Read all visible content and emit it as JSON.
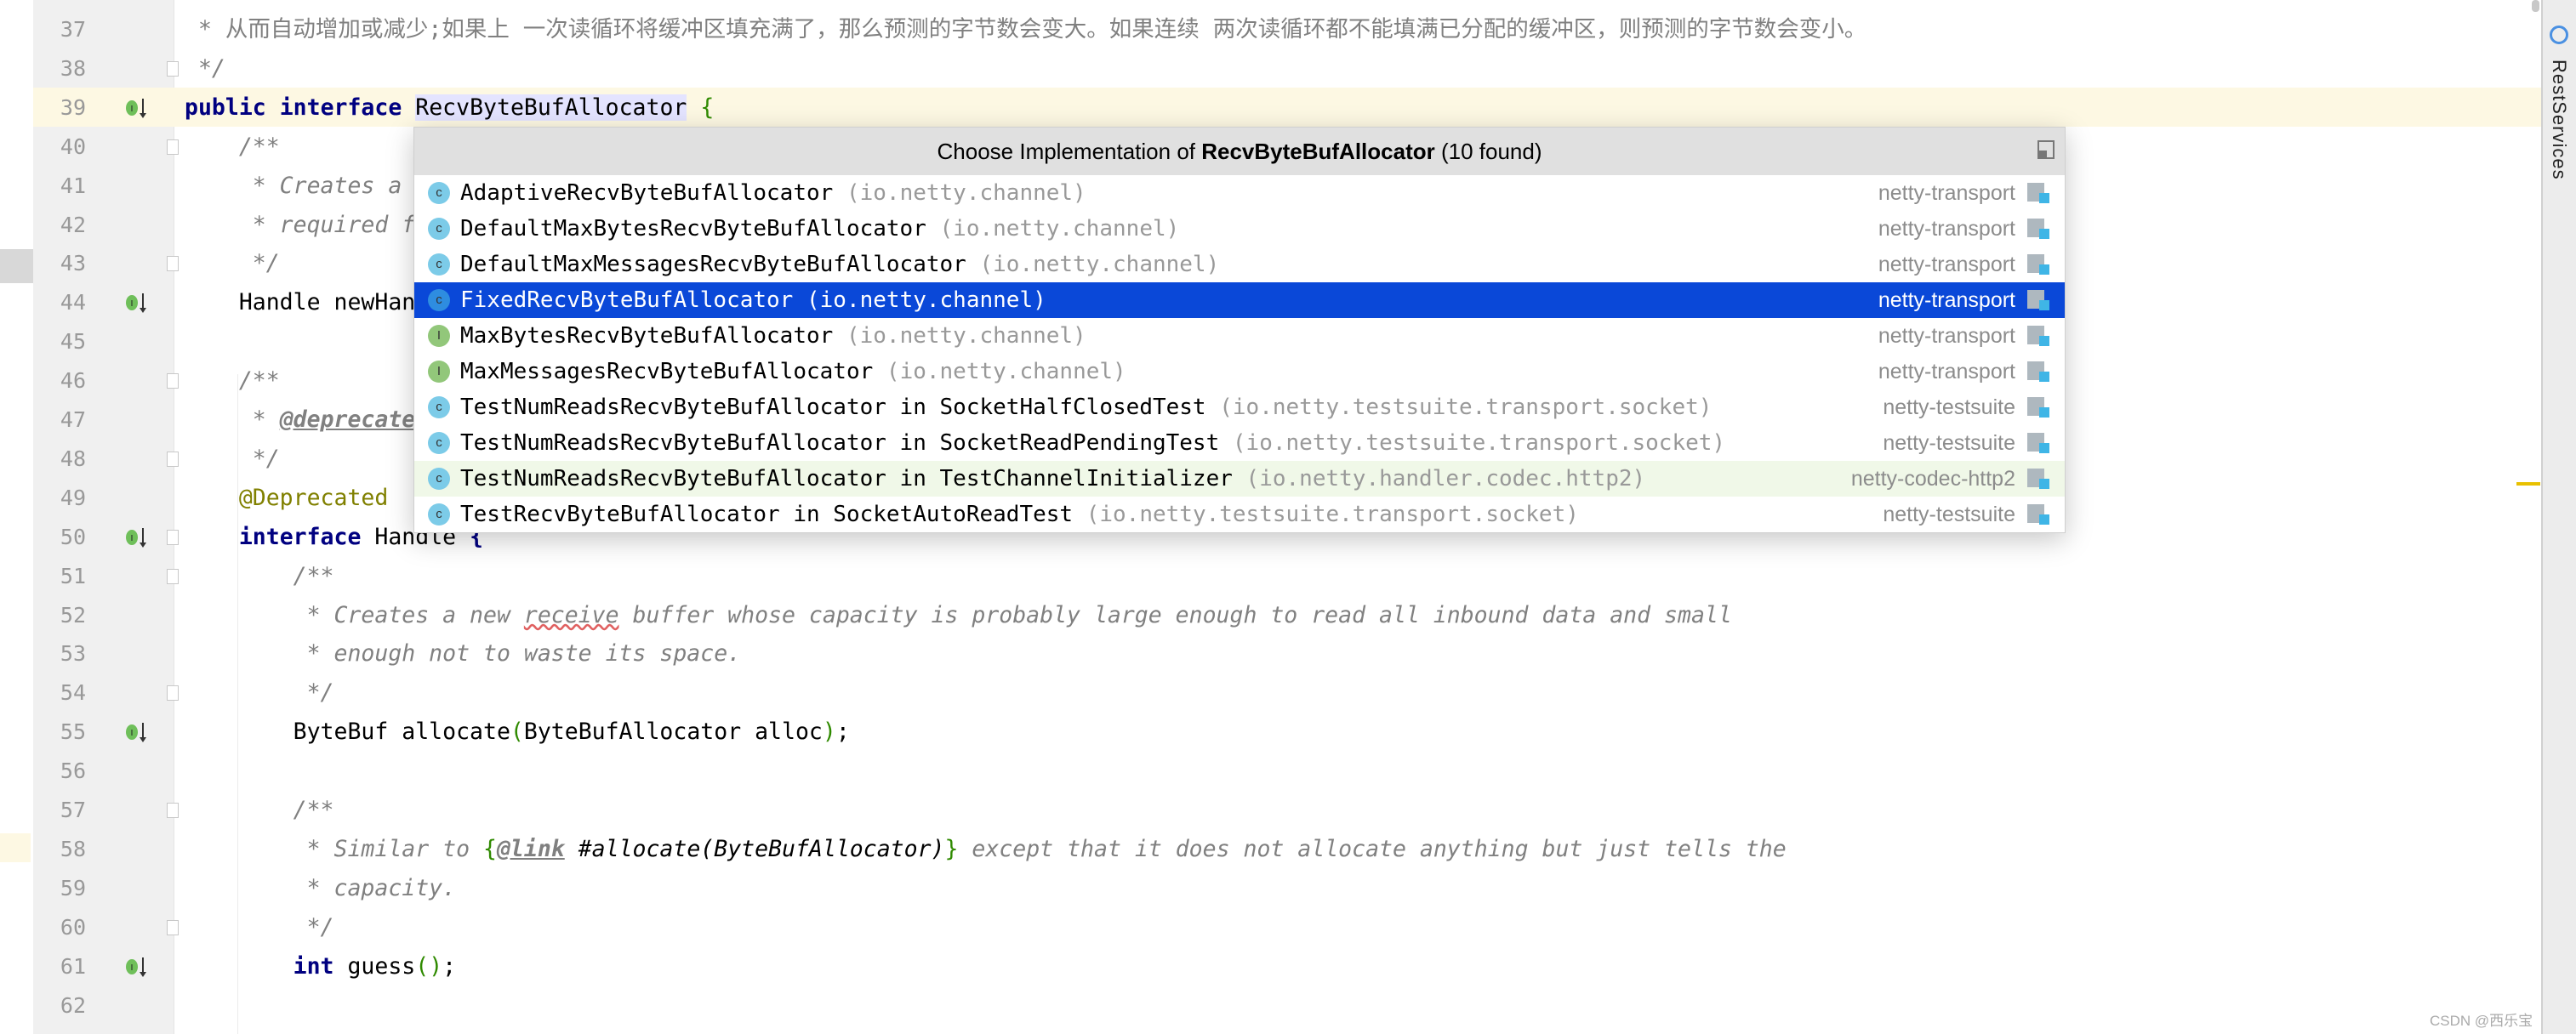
{
  "editor": {
    "current_line": 39,
    "lines": [
      {
        "n": "37",
        "gutter": null,
        "fold": false,
        "tokens": [
          {
            "t": " * 从而自动增加或减少;如果上 一次读循环将缓冲区填充满了，那么预测的字节数会变大。如果连续 两次读循环都不能填满已分配的缓冲区，则预测的字节数会变小。",
            "c": "cmn"
          }
        ]
      },
      {
        "n": "38",
        "gutter": null,
        "fold": true,
        "tokens": [
          {
            "t": " */",
            "c": "cm"
          }
        ]
      },
      {
        "n": "39",
        "gutter": "implemented-icon",
        "fold": false,
        "tokens": [
          {
            "t": "public",
            "c": "kw"
          },
          {
            "t": " ",
            "c": ""
          },
          {
            "t": "interface",
            "c": "kw"
          },
          {
            "t": " ",
            "c": ""
          },
          {
            "t": "RecvByteBufAllocator",
            "c": "hl"
          },
          {
            "t": " ",
            "c": ""
          },
          {
            "t": "{",
            "c": "gr"
          }
        ]
      },
      {
        "n": "40",
        "gutter": null,
        "fold": true,
        "tokens": [
          {
            "t": "    /**",
            "c": "cm"
          }
        ]
      },
      {
        "n": "41",
        "gutter": null,
        "fold": false,
        "tokens": [
          {
            "t": "     * Creates a",
            "c": "cm"
          }
        ]
      },
      {
        "n": "42",
        "gutter": null,
        "fold": false,
        "tokens": [
          {
            "t": "     * required f",
            "c": "cm"
          }
        ]
      },
      {
        "n": "43",
        "gutter": null,
        "fold": true,
        "tokens": [
          {
            "t": "     */",
            "c": "cm"
          }
        ]
      },
      {
        "n": "44",
        "gutter": "implemented-icon",
        "fold": false,
        "tokens": [
          {
            "t": "    Handle newHan",
            "c": ""
          }
        ]
      },
      {
        "n": "45",
        "gutter": null,
        "fold": false,
        "tokens": []
      },
      {
        "n": "46",
        "gutter": null,
        "fold": true,
        "tokens": [
          {
            "t": "    /**",
            "c": "cm"
          }
        ]
      },
      {
        "n": "47",
        "gutter": null,
        "fold": false,
        "tokens": [
          {
            "t": "     * ",
            "c": "cm"
          },
          {
            "t": "@deprecate",
            "c": "tag"
          }
        ]
      },
      {
        "n": "48",
        "gutter": null,
        "fold": true,
        "tokens": [
          {
            "t": "     */",
            "c": "cm"
          }
        ]
      },
      {
        "n": "49",
        "gutter": null,
        "fold": false,
        "tokens": [
          {
            "t": "    @Deprecated",
            "c": "ann"
          }
        ]
      },
      {
        "n": "50",
        "gutter": "implemented-icon",
        "fold": true,
        "tokens": [
          {
            "t": "    ",
            "c": ""
          },
          {
            "t": "interface",
            "c": "kw"
          },
          {
            "t": " Handle ",
            "c": ""
          },
          {
            "t": "{",
            "c": "kw"
          }
        ]
      },
      {
        "n": "51",
        "gutter": null,
        "fold": true,
        "tokens": [
          {
            "t": "        /**",
            "c": "cm"
          }
        ]
      },
      {
        "n": "52",
        "gutter": null,
        "fold": false,
        "tokens": [
          {
            "t": "         * Creates a new ",
            "c": "cm"
          },
          {
            "t": "receive",
            "c": "typo"
          },
          {
            "t": " buffer whose capacity is probably large enough to read all inbound data and small",
            "c": "cm"
          }
        ]
      },
      {
        "n": "53",
        "gutter": null,
        "fold": false,
        "tokens": [
          {
            "t": "         * enough not to waste its space.",
            "c": "cm"
          }
        ]
      },
      {
        "n": "54",
        "gutter": null,
        "fold": true,
        "tokens": [
          {
            "t": "         */",
            "c": "cm"
          }
        ]
      },
      {
        "n": "55",
        "gutter": "implemented-icon",
        "fold": false,
        "tokens": [
          {
            "t": "        ByteBuf allocate",
            "c": ""
          },
          {
            "t": "(",
            "c": "gr"
          },
          {
            "t": "ByteBufAllocator alloc",
            "c": ""
          },
          {
            "t": ")",
            "c": "gr"
          },
          {
            "t": ";",
            "c": ""
          }
        ]
      },
      {
        "n": "56",
        "gutter": null,
        "fold": false,
        "tokens": []
      },
      {
        "n": "57",
        "gutter": null,
        "fold": true,
        "tokens": [
          {
            "t": "        /**",
            "c": "cm"
          }
        ]
      },
      {
        "n": "58",
        "gutter": null,
        "fold": false,
        "tokens": [
          {
            "t": "         * Similar to ",
            "c": "cm"
          },
          {
            "t": "{",
            "c": "gr"
          },
          {
            "t": "@link",
            "c": "tag"
          },
          {
            "t": " #allocate(ByteBufAllocator)",
            "c": "ref"
          },
          {
            "t": "}",
            "c": "gr"
          },
          {
            "t": " except that it does not allocate anything but just tells the",
            "c": "cm"
          }
        ]
      },
      {
        "n": "59",
        "gutter": null,
        "fold": false,
        "tokens": [
          {
            "t": "         * capacity.",
            "c": "cm"
          }
        ]
      },
      {
        "n": "60",
        "gutter": null,
        "fold": true,
        "tokens": [
          {
            "t": "         */",
            "c": "cm"
          }
        ]
      },
      {
        "n": "61",
        "gutter": "implemented-icon",
        "fold": false,
        "tokens": [
          {
            "t": "        ",
            "c": ""
          },
          {
            "t": "int",
            "c": "kw"
          },
          {
            "t": " guess",
            "c": ""
          },
          {
            "t": "()",
            "c": "gr"
          },
          {
            "t": ";",
            "c": ""
          }
        ]
      },
      {
        "n": "62",
        "gutter": null,
        "fold": false,
        "tokens": []
      }
    ]
  },
  "popup": {
    "title_prefix": "Choose Implementation of ",
    "title_bold": "RecvByteBufAllocator",
    "title_suffix": " (10 found)",
    "items": [
      {
        "icon": "class-icon",
        "kind": "c",
        "name": "AdaptiveRecvByteBufAllocator",
        "location": " (io.netty.channel)",
        "module": "netty-transport",
        "selected": false,
        "hilite": false
      },
      {
        "icon": "class-icon",
        "kind": "c",
        "name": "DefaultMaxBytesRecvByteBufAllocator",
        "location": " (io.netty.channel)",
        "module": "netty-transport",
        "selected": false,
        "hilite": false
      },
      {
        "icon": "abstract-class-icon",
        "kind": "c",
        "name": "DefaultMaxMessagesRecvByteBufAllocator",
        "location": " (io.netty.channel)",
        "module": "netty-transport",
        "selected": false,
        "hilite": false
      },
      {
        "icon": "class-icon",
        "kind": "c",
        "name": "FixedRecvByteBufAllocator",
        "location": " (io.netty.channel)",
        "module": "netty-transport",
        "selected": true,
        "hilite": false
      },
      {
        "icon": "interface-icon",
        "kind": "i",
        "name": "MaxBytesRecvByteBufAllocator",
        "location": " (io.netty.channel)",
        "module": "netty-transport",
        "selected": false,
        "hilite": false
      },
      {
        "icon": "interface-icon",
        "kind": "i",
        "name": "MaxMessagesRecvByteBufAllocator",
        "location": " (io.netty.channel)",
        "module": "netty-transport",
        "selected": false,
        "hilite": false
      },
      {
        "icon": "inner-class-icon",
        "kind": "c",
        "name": "TestNumReadsRecvByteBufAllocator in SocketHalfClosedTest",
        "location": " (io.netty.testsuite.transport.socket)",
        "module": "netty-testsuite",
        "selected": false,
        "hilite": false
      },
      {
        "icon": "inner-class-icon",
        "kind": "c",
        "name": "TestNumReadsRecvByteBufAllocator in SocketReadPendingTest",
        "location": " (io.netty.testsuite.transport.socket)",
        "module": "netty-testsuite",
        "selected": false,
        "hilite": false
      },
      {
        "icon": "inner-class-icon",
        "kind": "c",
        "name": "TestNumReadsRecvByteBufAllocator in TestChannelInitializer",
        "location": " (io.netty.handler.codec.http2)",
        "module": "netty-codec-http2",
        "selected": false,
        "hilite": true
      },
      {
        "icon": "inner-class-icon",
        "kind": "c",
        "name": "TestRecvByteBufAllocator in SocketAutoReadTest",
        "location": " (io.netty.testsuite.transport.socket)",
        "module": "netty-testsuite",
        "selected": false,
        "hilite": false
      }
    ]
  },
  "sidebar": {
    "label": "RestServices",
    "icon": "rest-services-icon"
  },
  "watermark": "CSDN @西乐宝",
  "colors": {
    "selection": "#0a48d8",
    "current_line": "#fdf8e3",
    "keyword": "#000080",
    "comment": "#808080",
    "annotation": "#808000"
  }
}
